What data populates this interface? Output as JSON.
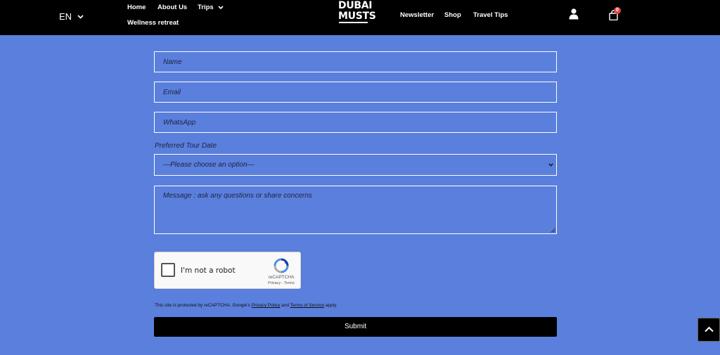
{
  "header": {
    "language": "EN",
    "nav_left": [
      {
        "label": "Home"
      },
      {
        "label": "About Us"
      },
      {
        "label": "Trips"
      },
      {
        "label": "Wellness retreat"
      }
    ],
    "logo_line1": "DUBAI",
    "logo_line2": "MUSTS",
    "nav_right": [
      {
        "label": "Newsletter"
      },
      {
        "label": "Shop"
      },
      {
        "label": "Travel Tips"
      }
    ],
    "cart_count": "0",
    "icons": [
      "chevron-down-icon",
      "user-icon",
      "cart-icon",
      "chevron-up-icon"
    ]
  },
  "form": {
    "name_placeholder": "Name",
    "email_placeholder": "Email",
    "whatsapp_placeholder": "WhatsApp",
    "date_label": "Preferred Tour Date",
    "date_selected": "—Please choose an option—",
    "message_placeholder": "Message : ask any questions or share concerns",
    "recaptcha_label": "I'm not a robot",
    "recaptcha_brand": "reCAPTCHA",
    "recaptcha_terms": "Privacy - Terms",
    "protected_prefix": "This site is protected by reCAPTCHA. Google's",
    "privacy_link": "Privacy Policy",
    "protected_and": "and",
    "terms_link": "Terms of Service",
    "protected_suffix": "apply.",
    "submit_label": "Submit"
  },
  "colors": {
    "background": "#5b7fdc",
    "header": "#000000",
    "badge": "#e04848"
  }
}
